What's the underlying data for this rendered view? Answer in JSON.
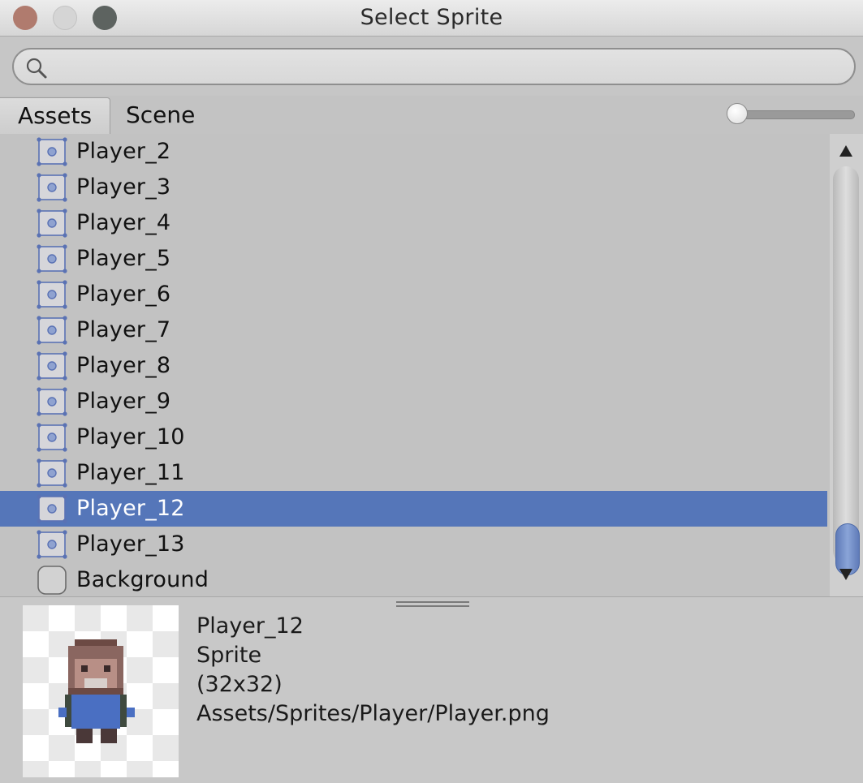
{
  "window": {
    "title": "Select Sprite"
  },
  "search": {
    "value": "",
    "placeholder": ""
  },
  "tabs": [
    {
      "label": "Assets",
      "active": true
    },
    {
      "label": "Scene",
      "active": false
    }
  ],
  "list": {
    "items": [
      {
        "label": "Player_2",
        "icon": "sprite-icon",
        "selected": false
      },
      {
        "label": "Player_3",
        "icon": "sprite-icon",
        "selected": false
      },
      {
        "label": "Player_4",
        "icon": "sprite-icon",
        "selected": false
      },
      {
        "label": "Player_5",
        "icon": "sprite-icon",
        "selected": false
      },
      {
        "label": "Player_6",
        "icon": "sprite-icon",
        "selected": false
      },
      {
        "label": "Player_7",
        "icon": "sprite-icon",
        "selected": false
      },
      {
        "label": "Player_8",
        "icon": "sprite-icon",
        "selected": false
      },
      {
        "label": "Player_9",
        "icon": "sprite-icon",
        "selected": false
      },
      {
        "label": "Player_10",
        "icon": "sprite-icon",
        "selected": false
      },
      {
        "label": "Player_11",
        "icon": "sprite-icon",
        "selected": false
      },
      {
        "label": "Player_12",
        "icon": "sprite-icon",
        "selected": true
      },
      {
        "label": "Player_13",
        "icon": "sprite-icon",
        "selected": false
      },
      {
        "label": "Background",
        "icon": "blank-sprite-icon",
        "selected": false
      }
    ]
  },
  "preview": {
    "name": "Player_12",
    "type": "Sprite",
    "size": "(32x32)",
    "path": "Assets/Sprites/Player/Player.png"
  },
  "colors": {
    "selection": "#5576b9",
    "sprite_icon": "#5a72b4",
    "close_button": "#b07b6e"
  }
}
